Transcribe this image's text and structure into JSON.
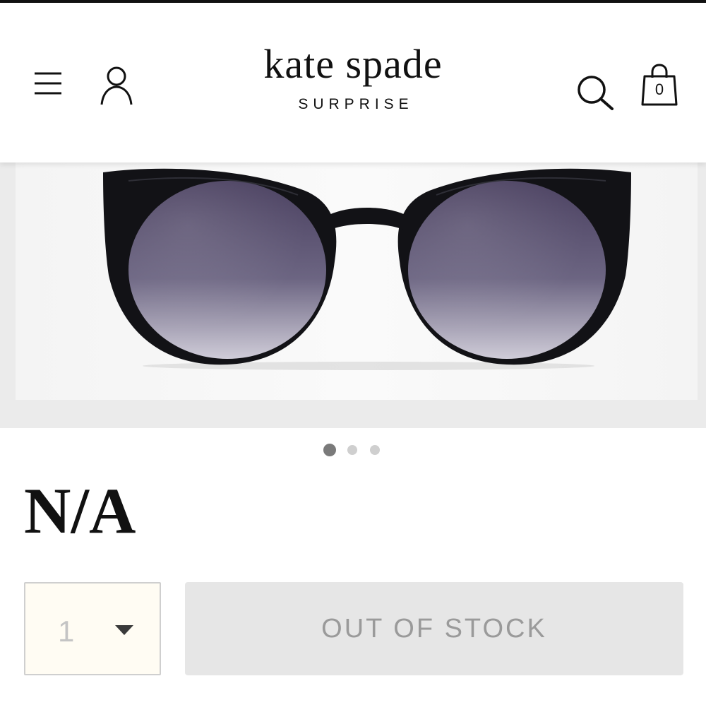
{
  "header": {
    "brand_name": "kate spade",
    "brand_sub": "SURPRISE",
    "bag_count": "0",
    "icons": {
      "menu": "hamburger-menu-icon",
      "account": "user-account-icon",
      "search": "search-icon",
      "bag": "shopping-bag-icon"
    }
  },
  "gallery": {
    "image_subject": "black cat-eye sunglasses with gradient lenses",
    "slide_count": 3,
    "active_slide": 1
  },
  "product": {
    "title": "N/A"
  },
  "purchase": {
    "quantity": "1",
    "button_label": "OUT OF STOCK"
  },
  "colors": {
    "text": "#111111",
    "qty_bg": "#fffcf3",
    "disabled_bg": "#e6e6e6",
    "disabled_text": "#9a9a9a",
    "dot_active": "#7a7a7a",
    "dot_inactive": "#cfcfcf"
  }
}
